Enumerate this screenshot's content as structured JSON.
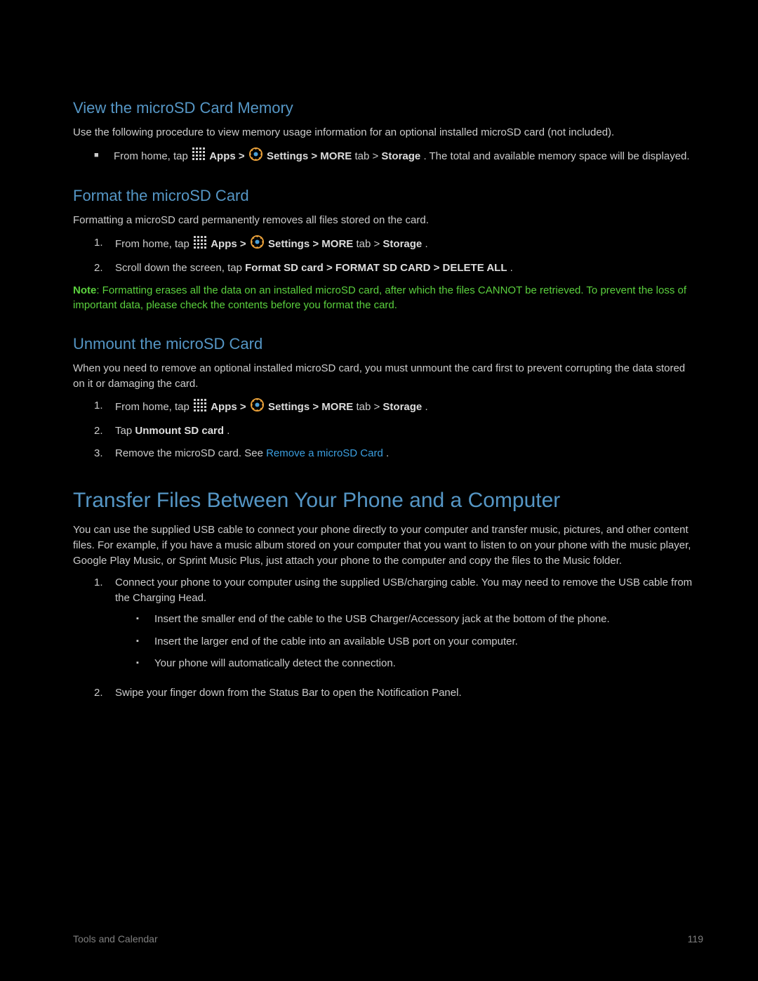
{
  "s1": {
    "heading": "View the microSD Card Memory",
    "intro": "Use the following procedure to view memory usage information for an optional installed microSD card (not included).",
    "bullet_pre": "From home, tap ",
    "nav_apps": "Apps",
    "nav_gt1": " > ",
    "nav_settings": "Settings",
    "nav_more": " > MORE",
    "nav_tab": " tab > ",
    "nav_storage": "Storage",
    "bullet_post": ". The total and available memory space will be displayed."
  },
  "s2": {
    "heading": "Format the microSD Card",
    "intro": "Formatting a microSD card permanently removes all files stored on the card.",
    "step1_pre": "From home, tap ",
    "step1_apps": "Apps",
    "step1_gt1": " > ",
    "step1_settings": "Settings",
    "step1_more": " > MORE",
    "step1_tab": " tab > ",
    "step1_storage": "Storage",
    "step1_end": ".",
    "step2_pre": "Scroll down the screen, tap ",
    "step2_bold": "Format SD card > FORMAT SD CARD > DELETE ALL",
    "step2_end": ".",
    "note_label": "Note",
    "note_body": ": Formatting erases all the data on an installed microSD card, after which the files CANNOT be retrieved. To prevent the loss of important data, please check the contents before you format the card."
  },
  "s3": {
    "heading": "Unmount the microSD Card",
    "intro": "When you need to remove an optional installed microSD card, you must unmount the card first to prevent corrupting the data stored on it or damaging the card.",
    "step1_pre": "From home, tap ",
    "step1_apps": "Apps",
    "step1_gt1": " > ",
    "step1_settings": "Settings",
    "step1_more": " > MORE",
    "step1_tab": " tab > ",
    "step1_storage": "Storage",
    "step1_end": ".",
    "step2_pre": "Tap ",
    "step2_bold": "Unmount SD card",
    "step2_end": ".",
    "step3_pre": "Remove the microSD card. See ",
    "step3_link": "Remove a microSD Card",
    "step3_end": "."
  },
  "s4": {
    "heading": "Transfer Files Between Your Phone and a Computer",
    "intro": "You can use the supplied USB cable to connect your phone directly to your computer and transfer music, pictures, and other content files. For example, if you have a music album stored on your computer that you want to listen to on your phone with the music player, Google Play Music, or Sprint Music Plus, just attach your phone to the computer and copy the files to the Music folder.",
    "step1": "Connect your phone to your computer using the supplied USB/charging cable. You may need to remove the USB cable from the Charging Head.",
    "sub1": "Insert the smaller end of the cable to the USB Charger/Accessory jack at the bottom of the phone.",
    "sub2": "Insert the larger end of the cable into an available USB port on your computer.",
    "sub3": "Your phone will automatically detect the connection.",
    "step2": "Swipe your finger down from the Status Bar to open the Notification Panel."
  },
  "footer": {
    "section": "Tools and Calendar",
    "page": "119"
  }
}
